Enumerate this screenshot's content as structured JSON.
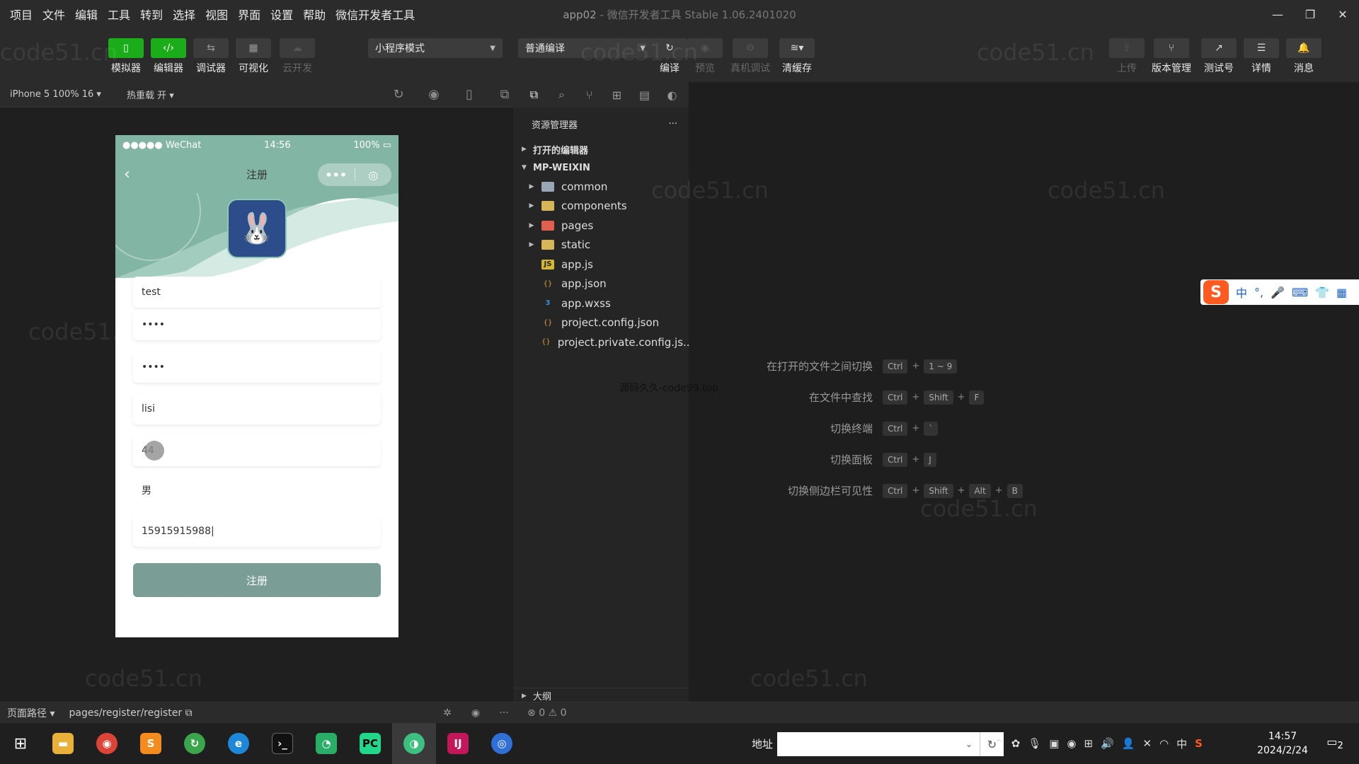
{
  "menubar": {
    "items": [
      "项目",
      "文件",
      "编辑",
      "工具",
      "转到",
      "选择",
      "视图",
      "界面",
      "设置",
      "帮助",
      "微信开发者工具"
    ],
    "title": "app02",
    "title_sub": "微信开发者工具 Stable 1.06.2401020"
  },
  "toolbar": {
    "left_buttons": [
      {
        "label": "模拟器",
        "icon": "phone-icon"
      },
      {
        "label": "编辑器",
        "icon": "code-icon"
      },
      {
        "label": "调试器",
        "icon": "debug-icon"
      },
      {
        "label": "可视化",
        "icon": "layout-icon"
      },
      {
        "label": "云开发",
        "icon": "cloud-icon"
      }
    ],
    "mode_select": "小程序模式",
    "compile_select": "普通编译",
    "mid_buttons": [
      {
        "label": "编译",
        "icon": "refresh-icon"
      },
      {
        "label": "预览",
        "icon": "eye-icon"
      },
      {
        "label": "真机调试",
        "icon": "bug-icon"
      },
      {
        "label": "清缓存",
        "icon": "layers-icon"
      }
    ],
    "right_buttons": [
      {
        "label": "上传",
        "icon": "upload-icon"
      },
      {
        "label": "版本管理",
        "icon": "branch-icon"
      },
      {
        "label": "测试号",
        "icon": "external-icon"
      },
      {
        "label": "详情",
        "icon": "menu-icon"
      },
      {
        "label": "消息",
        "icon": "bell-icon"
      }
    ]
  },
  "simulator": {
    "device": "iPhone 5 100% 16",
    "hot_reload": "热重载 开",
    "phone": {
      "carrier": "●●●●● WeChat",
      "time": "14:56",
      "battery": "100%",
      "nav_title": "注册",
      "fields": [
        "test",
        "••••",
        "••••",
        "lisi",
        "44",
        "男",
        "15915915988"
      ],
      "submit_label": "注册"
    }
  },
  "explorer": {
    "title": "资源管理器",
    "open_editors": "打开的编辑器",
    "project": "MP-WEIXIN",
    "items": [
      {
        "name": "common",
        "type": "folder"
      },
      {
        "name": "components",
        "type": "folder-yellow"
      },
      {
        "name": "pages",
        "type": "folder-red"
      },
      {
        "name": "static",
        "type": "folder-yellow"
      },
      {
        "name": "app.js",
        "type": "js"
      },
      {
        "name": "app.json",
        "type": "json"
      },
      {
        "name": "app.wxss",
        "type": "css"
      },
      {
        "name": "project.config.json",
        "type": "json"
      },
      {
        "name": "project.private.config.js...",
        "type": "json"
      }
    ],
    "outline": "大纲"
  },
  "editor": {
    "center_text": "源码久久-code99.top",
    "shortcuts": [
      {
        "label": "在打开的文件之间切换",
        "keys": [
          "Ctrl",
          "1 ~ 9"
        ]
      },
      {
        "label": "在文件中查找",
        "keys": [
          "Ctrl",
          "Shift",
          "F"
        ]
      },
      {
        "label": "切换终端",
        "keys": [
          "Ctrl",
          "`"
        ]
      },
      {
        "label": "切换面板",
        "keys": [
          "Ctrl",
          "J"
        ]
      },
      {
        "label": "切换侧边栏可见性",
        "keys": [
          "Ctrl",
          "Shift",
          "Alt",
          "B"
        ]
      }
    ]
  },
  "ime": {
    "items": [
      "中",
      "°,",
      "🎤",
      "⌨",
      "👕",
      "▦"
    ]
  },
  "statusbar": {
    "path_label": "页面路径",
    "path": "pages/register/register",
    "errors": "0",
    "warnings": "0"
  },
  "taskbar": {
    "address_label": "地址",
    "tray_lang": "中",
    "time": "14:57",
    "date": "2024/2/24",
    "notif_count": "2"
  },
  "watermark": "code51.cn"
}
